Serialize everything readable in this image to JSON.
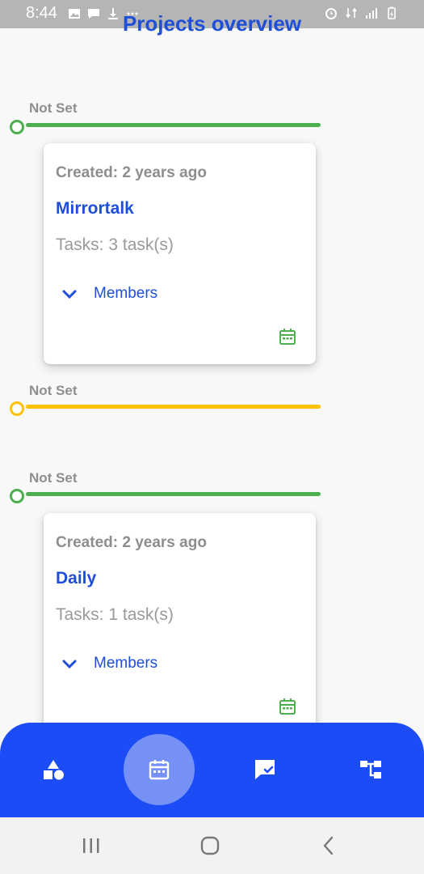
{
  "status_bar": {
    "time": "8:44",
    "left_icons": [
      "image-icon",
      "message-icon",
      "download-icon",
      "more-icon"
    ],
    "right_icons": [
      "alarm-icon",
      "data-icon",
      "signal-icon",
      "battery-icon"
    ]
  },
  "page": {
    "title": "Projects overview"
  },
  "timeline": [
    {
      "label": "Not Set",
      "color": "#4caf50"
    },
    {
      "label": "Not Set",
      "color": "#ffc107"
    },
    {
      "label": "Not Set",
      "color": "#4caf50"
    }
  ],
  "projects": [
    {
      "created": "Created: 2 years ago",
      "name": "Mirrortalk",
      "tasks": "Tasks: 3 task(s)",
      "members_label": "Members",
      "icon": "calendar-icon"
    },
    {
      "created": "Created: 2 years ago",
      "name": "Daily",
      "tasks": "Tasks: 1 task(s)",
      "members_label": "Members",
      "icon": "calendar-icon"
    }
  ],
  "bottom_nav": {
    "items": [
      {
        "icon": "shapes-icon",
        "active": false
      },
      {
        "icon": "calendar-icon",
        "active": true
      },
      {
        "icon": "chat-check-icon",
        "active": false
      },
      {
        "icon": "hierarchy-icon",
        "active": false
      }
    ],
    "color": "#1c4cf5",
    "active_color": "#7591f5"
  },
  "system_nav": {
    "buttons": [
      "recents-icon",
      "home-icon",
      "back-icon"
    ]
  },
  "colors": {
    "accent": "#1f4ed8",
    "muted_text": "#8e8e8e",
    "success": "#4caf50",
    "warning": "#ffc107"
  }
}
